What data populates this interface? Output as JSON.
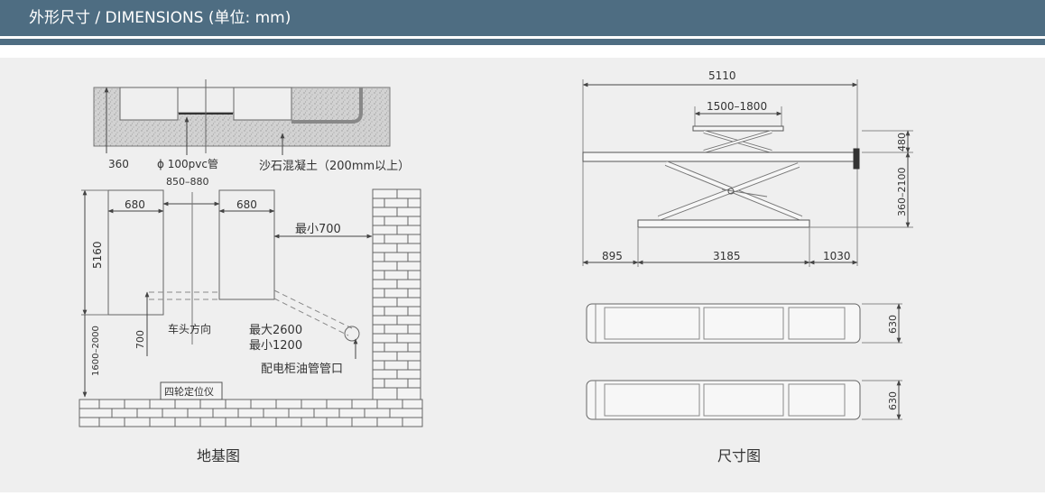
{
  "header": {
    "title": "外形尺寸 / DIMENSIONS (单位: mm)",
    "accent_color": "#4e6d82"
  },
  "foundation": {
    "caption": "地基图",
    "labels": {
      "depth": "360",
      "pvc": "ϕ 100pvc管",
      "concrete": "沙石混凝土（200mm以上）",
      "spacing": "850–880",
      "width_left": "680",
      "width_right": "680",
      "min_wall": "最小700",
      "length": "5160",
      "gap": "700",
      "front_range": "1600–2000",
      "direction": "车头方向",
      "max": "最大2600",
      "min": "最小1200",
      "outlet": "配电柜油管管口",
      "aligner": "四轮定位仪"
    }
  },
  "dimensions": {
    "caption": "尺寸图",
    "labels": {
      "total_length": "5110",
      "platform_range": "1500–1800",
      "min_height": "480",
      "lift_range": "360–2100",
      "left_offset": "895",
      "base_length": "3185",
      "right_offset": "1030",
      "plate_width_top": "630",
      "plate_width_bottom": "630"
    }
  }
}
